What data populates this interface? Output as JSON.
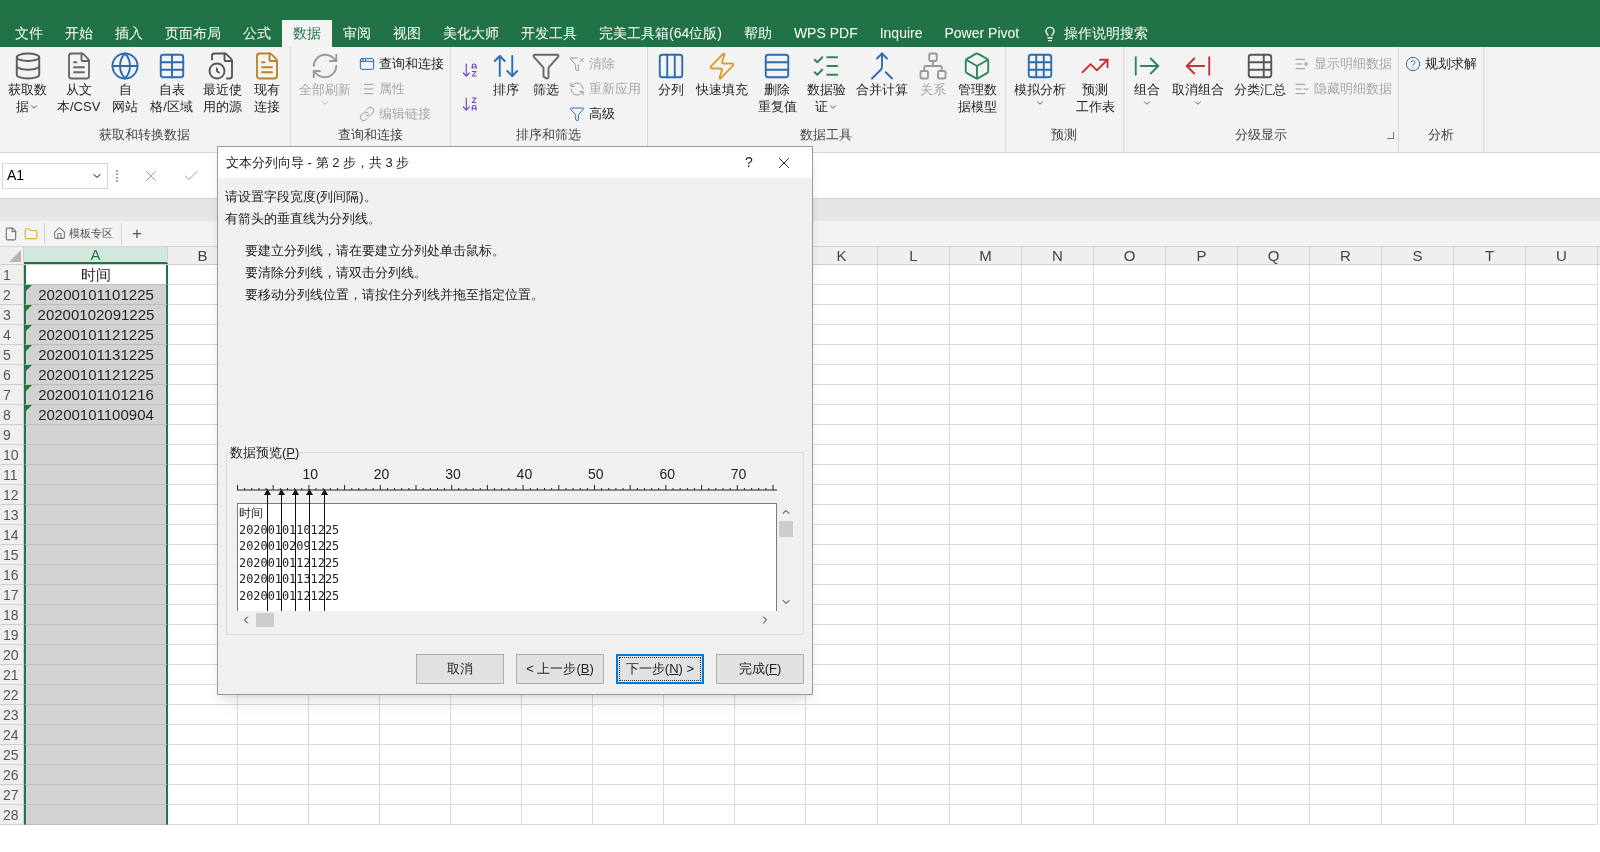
{
  "tabs": [
    {
      "label": "文件",
      "selected": false
    },
    {
      "label": "开始",
      "selected": false
    },
    {
      "label": "插入",
      "selected": false
    },
    {
      "label": "页面布局",
      "selected": false
    },
    {
      "label": "公式",
      "selected": false
    },
    {
      "label": "数据",
      "selected": true
    },
    {
      "label": "审阅",
      "selected": false
    },
    {
      "label": "视图",
      "selected": false
    },
    {
      "label": "美化大师",
      "selected": false
    },
    {
      "label": "开发工具",
      "selected": false
    },
    {
      "label": "完美工具箱(64位版)",
      "selected": false
    },
    {
      "label": "帮助",
      "selected": false
    },
    {
      "label": "WPS PDF",
      "selected": false
    },
    {
      "label": "Inquire",
      "selected": false
    },
    {
      "label": "Power Pivot",
      "selected": false
    }
  ],
  "tell_me": "操作说明搜索",
  "ribbon": [
    {
      "label": "获取和转换数据",
      "items": [
        {
          "kind": "large",
          "lines": [
            "获取数",
            "据"
          ],
          "dropdown": true,
          "disabled": false
        },
        {
          "kind": "large",
          "lines": [
            "从文",
            "本/CSV"
          ],
          "dropdown": false,
          "disabled": false
        },
        {
          "kind": "large",
          "lines": [
            "自",
            "网站"
          ],
          "dropdown": false,
          "disabled": false
        },
        {
          "kind": "large",
          "lines": [
            "自表",
            "格/区域"
          ],
          "dropdown": false,
          "disabled": false
        },
        {
          "kind": "large",
          "lines": [
            "最近使",
            "用的源"
          ],
          "dropdown": false,
          "disabled": false
        },
        {
          "kind": "large",
          "lines": [
            "现有",
            "连接"
          ],
          "dropdown": false,
          "disabled": false
        }
      ]
    },
    {
      "label": "查询和连接",
      "items": [
        {
          "kind": "large",
          "lines": [
            "全部刷新"
          ],
          "dropdown": true,
          "disabled": true
        },
        {
          "kind": "stack",
          "items": [
            {
              "label": "查询和连接",
              "disabled": false
            },
            {
              "label": "属性",
              "disabled": true
            },
            {
              "label": "编辑链接",
              "disabled": true
            }
          ]
        }
      ]
    },
    {
      "label": "排序和筛选",
      "items": [
        {
          "kind": "icon-stack"
        },
        {
          "kind": "large",
          "lines": [
            "排序"
          ],
          "dropdown": false,
          "disabled": false
        },
        {
          "kind": "large",
          "lines": [
            "筛选"
          ],
          "dropdown": false,
          "disabled": false
        },
        {
          "kind": "stack",
          "items": [
            {
              "label": "清除",
              "disabled": true
            },
            {
              "label": "重新应用",
              "disabled": true
            },
            {
              "label": "高级",
              "disabled": false
            }
          ]
        }
      ]
    },
    {
      "label": "数据工具",
      "items": [
        {
          "kind": "large",
          "lines": [
            "分列"
          ],
          "dropdown": false,
          "disabled": false
        },
        {
          "kind": "large",
          "lines": [
            "快速填充"
          ],
          "dropdown": false,
          "disabled": false
        },
        {
          "kind": "large",
          "lines": [
            "删除",
            "重复值"
          ],
          "dropdown": false,
          "disabled": false
        },
        {
          "kind": "large",
          "lines": [
            "数据验",
            "证"
          ],
          "dropdown": true,
          "disabled": false
        },
        {
          "kind": "large",
          "lines": [
            "合并计算"
          ],
          "dropdown": false,
          "disabled": false
        },
        {
          "kind": "large",
          "lines": [
            "关系"
          ],
          "dropdown": false,
          "disabled": true
        },
        {
          "kind": "large",
          "lines": [
            "管理数",
            "据模型"
          ],
          "dropdown": false,
          "disabled": false
        }
      ]
    },
    {
      "label": "预测",
      "items": [
        {
          "kind": "large",
          "lines": [
            "模拟分析"
          ],
          "dropdown": true,
          "disabled": false
        },
        {
          "kind": "large",
          "lines": [
            "预测",
            "工作表"
          ],
          "dropdown": false,
          "disabled": false
        }
      ]
    },
    {
      "label": "分级显示",
      "launcher": true,
      "items": [
        {
          "kind": "large",
          "lines": [
            "组合"
          ],
          "dropdown": true,
          "disabled": false
        },
        {
          "kind": "large",
          "lines": [
            "取消组合"
          ],
          "dropdown": true,
          "disabled": false
        },
        {
          "kind": "large",
          "lines": [
            "分类汇总"
          ],
          "dropdown": false,
          "disabled": false
        },
        {
          "kind": "stack",
          "items": [
            {
              "label": "显示明细数据",
              "disabled": true
            },
            {
              "label": "隐藏明细数据",
              "disabled": true
            }
          ]
        }
      ]
    },
    {
      "label": "分析",
      "items": [
        {
          "kind": "stack",
          "items": [
            {
              "label": "规划求解",
              "disabled": false
            }
          ]
        }
      ]
    }
  ],
  "name_box": "A1",
  "sheet_strip": {
    "template_tab": "模板专区",
    "add": "+"
  },
  "grid": {
    "columns_left": [
      {
        "label": "A",
        "selected": true
      },
      {
        "label": "B",
        "selected": false
      }
    ],
    "columns_right": [
      {
        "label": "K",
        "selected": false
      },
      {
        "label": "L",
        "selected": false
      },
      {
        "label": "M",
        "selected": false
      },
      {
        "label": "N",
        "selected": false
      },
      {
        "label": "O",
        "selected": false
      },
      {
        "label": "P",
        "selected": false
      },
      {
        "label": "Q",
        "selected": false
      },
      {
        "label": "R",
        "selected": false
      },
      {
        "label": "S",
        "selected": false
      },
      {
        "label": "T",
        "selected": false
      },
      {
        "label": "U",
        "selected": false
      }
    ],
    "rows": [
      {
        "number": "1",
        "a": "时间",
        "flagged": false
      },
      {
        "number": "2",
        "a": "20200101101225",
        "flagged": true
      },
      {
        "number": "3",
        "a": "20200102091225",
        "flagged": true
      },
      {
        "number": "4",
        "a": "20200101121225",
        "flagged": true
      },
      {
        "number": "5",
        "a": "20200101131225",
        "flagged": true
      },
      {
        "number": "6",
        "a": "20200101121225",
        "flagged": true
      },
      {
        "number": "7",
        "a": "20200101101216",
        "flagged": true
      },
      {
        "number": "8",
        "a": "20200101100904",
        "flagged": true
      },
      {
        "number": "9"
      },
      {
        "number": "10"
      },
      {
        "number": "11"
      },
      {
        "number": "12"
      },
      {
        "number": "13"
      },
      {
        "number": "14"
      },
      {
        "number": "15"
      },
      {
        "number": "16"
      },
      {
        "number": "17"
      },
      {
        "number": "18"
      },
      {
        "number": "19"
      },
      {
        "number": "20"
      },
      {
        "number": "21"
      },
      {
        "number": "22"
      },
      {
        "number": "23"
      },
      {
        "number": "24"
      },
      {
        "number": "25"
      },
      {
        "number": "26"
      },
      {
        "number": "27"
      },
      {
        "number": "28"
      }
    ]
  },
  "dialog": {
    "title": "文本分列向导 - 第 2 步，共 3 步",
    "help": "?",
    "intro": [
      "请设置字段宽度(列间隔)。",
      "有箭头的垂直线为分列线。"
    ],
    "instructions": [
      "要建立分列线，请在要建立分列处单击鼠标。",
      "要清除分列线，请双击分列线。",
      "要移动分列线位置，请按住分列线并拖至指定位置。"
    ],
    "preview": {
      "label": {
        "before": "数据预览(",
        "key": "P",
        "after": ")"
      },
      "ruler_labels": [
        "10",
        "20",
        "30",
        "40",
        "50",
        "60",
        "70"
      ],
      "breaks": [
        {
          "level": 0.053
        },
        {
          "level": 0.079
        },
        {
          "level": 0.106
        },
        {
          "level": 0.132
        },
        {
          "level": 0.159
        }
      ],
      "rows": [
        "时间",
        "20200101101225",
        "20200102091225",
        "20200101121225",
        "20200101131225",
        "20200101121225"
      ]
    },
    "buttons": [
      {
        "before": "取消",
        "default": false
      },
      {
        "before": "< 上一步(",
        "key": "B",
        "after": ")",
        "default": false
      },
      {
        "before": "下一步(",
        "key": "N",
        "after": ") >",
        "default": true
      },
      {
        "before": "完成(",
        "key": "F",
        "after": ")",
        "default": false
      }
    ]
  }
}
